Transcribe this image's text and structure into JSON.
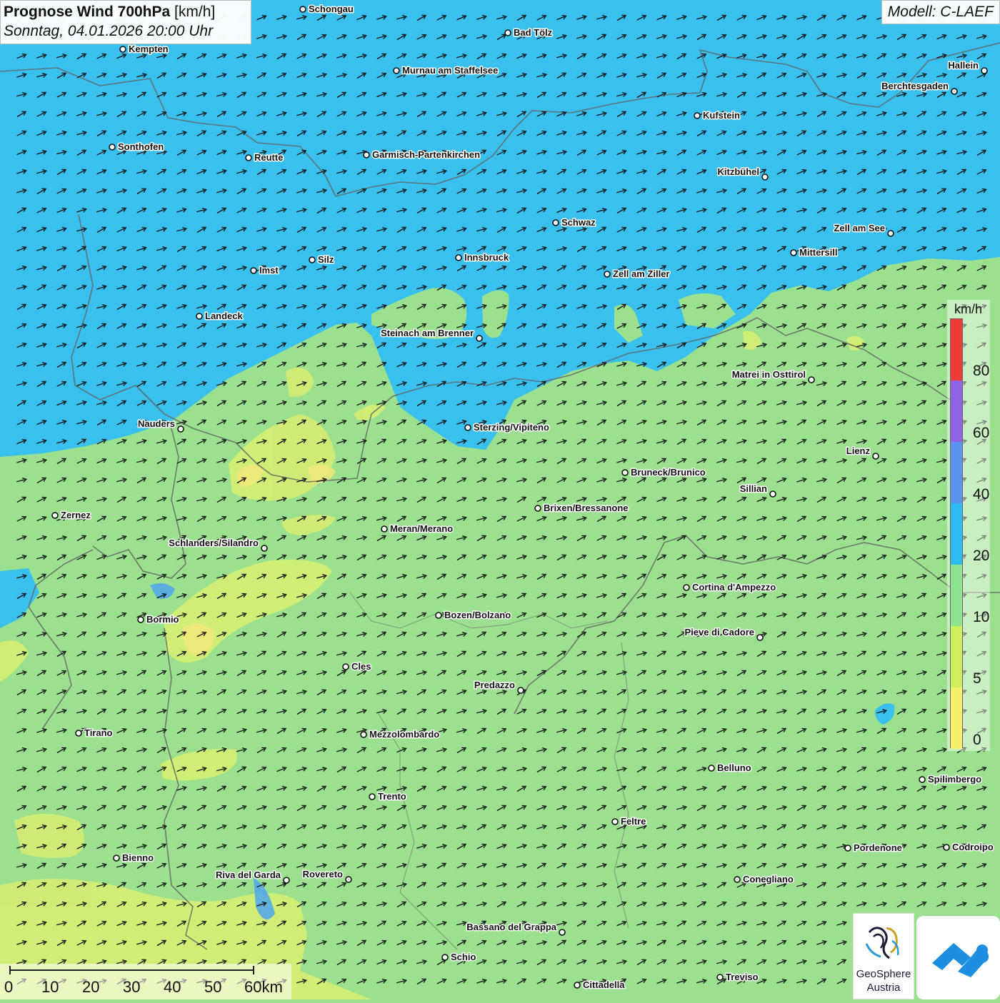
{
  "title": {
    "main": "Prognose Wind 700hPa",
    "unit": "[km/h]",
    "datetime": "Sonntag, 04.01.2026 20:00 Uhr"
  },
  "model": "Modell: C-LAEF",
  "legend": {
    "unit": "km/h",
    "ticks": [
      "80",
      "60",
      "40",
      "20",
      "10",
      "5",
      "0"
    ],
    "colors": [
      "#ef3b36",
      "#8e64e4",
      "#5b93ec",
      "#2cbcf0",
      "#8fe38e",
      "#cdef5c",
      "#f5f06a"
    ]
  },
  "map_colors": {
    "cyan_band": "#39c0ee",
    "green_band": "#9be08f",
    "yellow_band": "#d9ee72"
  },
  "scalebar": {
    "labels": [
      "0",
      "10",
      "20",
      "30",
      "40",
      "50",
      "60km"
    ]
  },
  "logos": {
    "geosphere_line1": "GeoSphere",
    "geosphere_line2": "Austria"
  },
  "cities": [
    {
      "name": "Schongau"
    },
    {
      "name": "Bad Tölz"
    },
    {
      "name": "Kempten"
    },
    {
      "name": "Murnau am Staffelsee"
    },
    {
      "name": "Hallein"
    },
    {
      "name": "Berchtesgaden"
    },
    {
      "name": "Kufstein"
    },
    {
      "name": "Sonthofen"
    },
    {
      "name": "Reutte"
    },
    {
      "name": "Garmisch-Partenkirchen"
    },
    {
      "name": "Kitzbühel"
    },
    {
      "name": "Schwaz"
    },
    {
      "name": "Zell am See"
    },
    {
      "name": "Mittersill"
    },
    {
      "name": "Silz"
    },
    {
      "name": "Innsbruck"
    },
    {
      "name": "Imst"
    },
    {
      "name": "Zell am Ziller"
    },
    {
      "name": "Landeck"
    },
    {
      "name": "Steinach am Brenner"
    },
    {
      "name": "Matrei in Osttirol"
    },
    {
      "name": "Nauders"
    },
    {
      "name": "Sterzing/Vipiteno"
    },
    {
      "name": "Lienz"
    },
    {
      "name": "Bruneck/Brunico"
    },
    {
      "name": "Sillian"
    },
    {
      "name": "Brixen/Bressanone"
    },
    {
      "name": "Zernez"
    },
    {
      "name": "Meran/Merano"
    },
    {
      "name": "Schlanders/Silandro"
    },
    {
      "name": "Cortina d'Ampezzo"
    },
    {
      "name": "Bozen/Bolzano"
    },
    {
      "name": "Bormio"
    },
    {
      "name": "Pieve di Cadore"
    },
    {
      "name": "Cles"
    },
    {
      "name": "Predazzo"
    },
    {
      "name": "Tirano"
    },
    {
      "name": "Mezzolombardo"
    },
    {
      "name": "Belluno"
    },
    {
      "name": "Spilimbergo"
    },
    {
      "name": "Trento"
    },
    {
      "name": "Feltre"
    },
    {
      "name": "Bienno"
    },
    {
      "name": "Pordenone"
    },
    {
      "name": "Codroipo"
    },
    {
      "name": "Riva del Garda"
    },
    {
      "name": "Rovereto"
    },
    {
      "name": "Conegliano"
    },
    {
      "name": "Bassano del Grappa"
    },
    {
      "name": "Schio"
    },
    {
      "name": "Treviso"
    },
    {
      "name": "Cittadella"
    }
  ]
}
